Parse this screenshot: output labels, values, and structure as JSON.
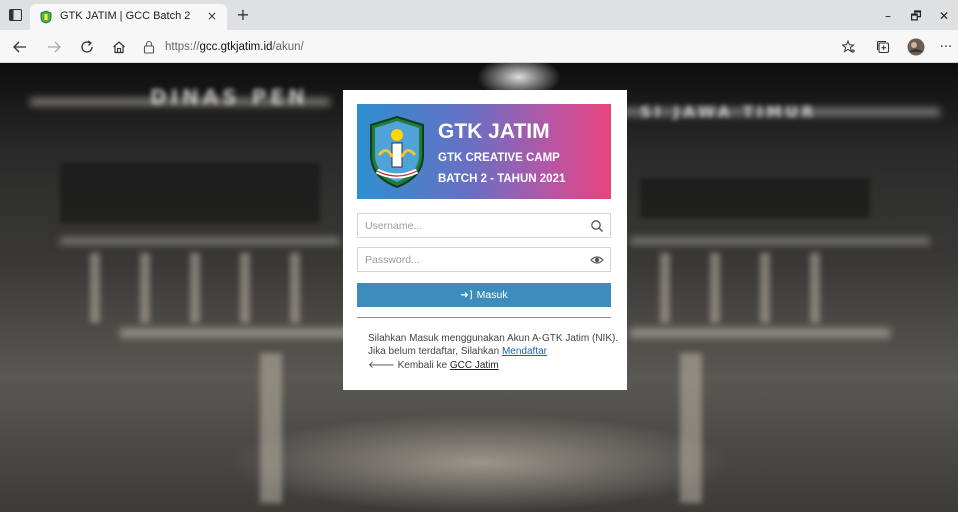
{
  "browser": {
    "tab_title": "GTK JATIM | GCC Batch 2",
    "tab_close": "×",
    "new_tab": "+",
    "url_scheme": "https://",
    "url_host": "gcc.gtkjatim.id",
    "url_path": "/akun/",
    "minimize": "–",
    "restore": "🗗",
    "close": "✕",
    "more": "···"
  },
  "background": {
    "sign_left": "DINAS PEN",
    "sign_right": "SI JAWA TIMUR"
  },
  "card": {
    "title": "GTK JATIM",
    "subtitle_1": "GTK CREATIVE CAMP",
    "subtitle_2": "BATCH 2 - TAHUN 2021",
    "username_placeholder": "Username...",
    "password_placeholder": "Password...",
    "login_icon": "➜]",
    "login_label": "Masuk",
    "info_line_1": "Silahkan Masuk menggunakan Akun A-GTK Jatim (NIK).",
    "info_line_2_prefix": "Jika belum terdaftar, Silahkan ",
    "register_link": "Mendaftar",
    "back_prefix": "🡐 Kembali ke ",
    "back_link": "GCC Jatim"
  },
  "colors": {
    "banner_start": "#2d8fd0",
    "banner_end": "#e8437e",
    "button": "#3c8dbc",
    "link": "#1a5fb4"
  }
}
